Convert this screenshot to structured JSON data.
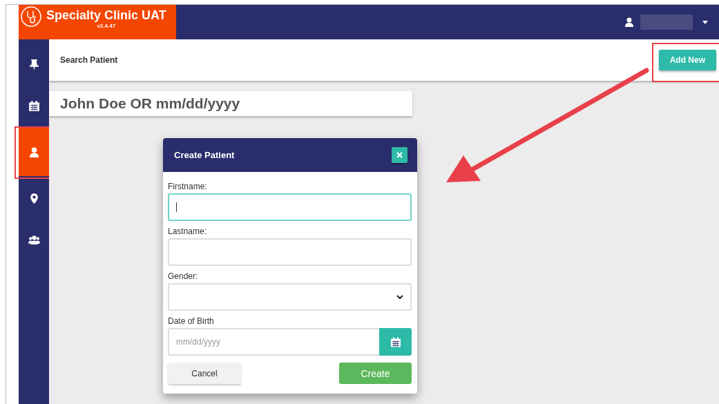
{
  "header": {
    "app_title": "Specialty Clinic UAT",
    "version": "v2.4.47"
  },
  "sidebar": {
    "items": [
      {
        "kind": "pin",
        "selected": false,
        "highlighted": false
      },
      {
        "kind": "calendar",
        "selected": false,
        "highlighted": false
      },
      {
        "kind": "person",
        "selected": true,
        "highlighted": true
      },
      {
        "kind": "location",
        "selected": false,
        "highlighted": false
      },
      {
        "kind": "group",
        "selected": false,
        "highlighted": false
      }
    ]
  },
  "page": {
    "title": "Search Patient",
    "add_button": {
      "label": "Add New",
      "highlighted": true
    },
    "search": {
      "placeholder": "John Doe OR mm/dd/yyyy"
    }
  },
  "dialog": {
    "title": "Create Patient",
    "fields": [
      {
        "kind": "text",
        "label": "Firstname:",
        "focused": true
      },
      {
        "kind": "text",
        "label": "Lastname:",
        "focused": false
      },
      {
        "kind": "select",
        "label": "Gender:",
        "focused": false
      },
      {
        "kind": "date",
        "label": "Date of Birth",
        "placeholder": "mm/dd/yyyy",
        "focused": false
      }
    ],
    "buttons": [
      {
        "kind": "secondary",
        "label": "Cancel"
      },
      {
        "kind": "primary",
        "label": "Create"
      }
    ]
  }
}
